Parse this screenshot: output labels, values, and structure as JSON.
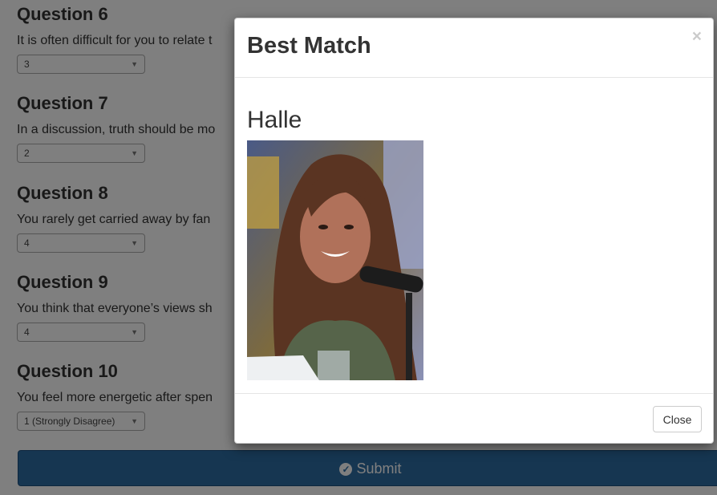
{
  "questions": [
    {
      "title": "Question 6",
      "text": "It is often difficult for you to relate t",
      "value": "3"
    },
    {
      "title": "Question 7",
      "text": "In a discussion, truth should be mo",
      "value": "2"
    },
    {
      "title": "Question 8",
      "text": "You rarely get carried away by fan",
      "value": "4"
    },
    {
      "title": "Question 9",
      "text": "You think that everyone’s views sh",
      "value": "4"
    },
    {
      "title": "Question 10",
      "text": "You feel more energetic after spen",
      "value": "1 (Strongly Disagree)"
    }
  ],
  "submit": {
    "label": "Submit",
    "icon": "check-circle-icon"
  },
  "modal": {
    "title": "Best Match",
    "close_symbol": "×",
    "match_name": "Halle",
    "photo_icon": "portrait-photo",
    "close_button": "Close"
  },
  "colors": {
    "submit": "#2d6ca2",
    "backdrop": "rgba(0,0,0,0.5)"
  }
}
